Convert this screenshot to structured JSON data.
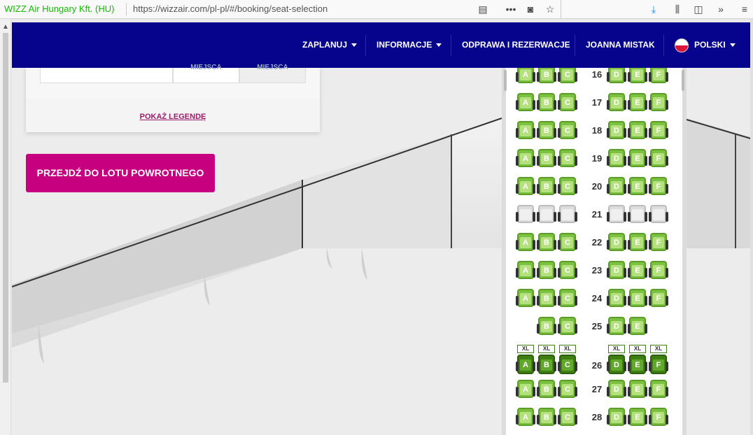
{
  "browser": {
    "identity": "WIZZ Air Hungary Kft. (HU)",
    "url": "https://wizzair.com/pl-pl/#/booking/seat-selection",
    "icons": [
      "reader-icon",
      "more-icon",
      "pocket-icon",
      "star-icon",
      "download-icon",
      "library-icon",
      "sidebar-icon",
      "overflow-icon",
      "menu-icon"
    ]
  },
  "nav": {
    "items": [
      {
        "label": "ZAPLANUJ",
        "dropdown": true
      },
      {
        "label": "INFORMACJE",
        "dropdown": true
      },
      {
        "label": "ODPRAWA I REZERWACJE",
        "dropdown": false
      },
      {
        "label": "JOANNA MISTAK",
        "dropdown": false
      },
      {
        "label": "POLSKI",
        "dropdown": true
      }
    ],
    "bg_color": "#06038d"
  },
  "panel": {
    "col1": "MIEJSCA",
    "col2": "MIEJSCA",
    "legend_link": "POKAŻ LEGENDĘ"
  },
  "cta": {
    "label": "PRZEJDŹ DO LOTU POWROTNEGO",
    "color": "#c6007e"
  },
  "seatmap": {
    "xl_label": "XL",
    "rows": [
      {
        "num": "16",
        "type": "normal",
        "left": [
          "A",
          "B",
          "C"
        ],
        "right": [
          "D",
          "E",
          "F"
        ]
      },
      {
        "num": "17",
        "type": "normal",
        "left": [
          "A",
          "B",
          "C"
        ],
        "right": [
          "D",
          "E",
          "F"
        ]
      },
      {
        "num": "18",
        "type": "normal",
        "left": [
          "A",
          "B",
          "C"
        ],
        "right": [
          "D",
          "E",
          "F"
        ]
      },
      {
        "num": "19",
        "type": "normal",
        "left": [
          "A",
          "B",
          "C"
        ],
        "right": [
          "D",
          "E",
          "F"
        ]
      },
      {
        "num": "20",
        "type": "normal",
        "left": [
          "A",
          "B",
          "C"
        ],
        "right": [
          "D",
          "E",
          "F"
        ]
      },
      {
        "num": "21",
        "type": "unavailable",
        "left": [
          "",
          "",
          ""
        ],
        "right": [
          "",
          "",
          ""
        ]
      },
      {
        "num": "22",
        "type": "normal",
        "left": [
          "A",
          "B",
          "C"
        ],
        "right": [
          "D",
          "E",
          "F"
        ]
      },
      {
        "num": "23",
        "type": "normal",
        "left": [
          "A",
          "B",
          "C"
        ],
        "right": [
          "D",
          "E",
          "F"
        ]
      },
      {
        "num": "24",
        "type": "normal",
        "left": [
          "A",
          "B",
          "C"
        ],
        "right": [
          "D",
          "E",
          "F"
        ]
      },
      {
        "num": "25",
        "type": "normal",
        "left": [
          null,
          "B",
          "C"
        ],
        "right": [
          "D",
          "E",
          null
        ]
      },
      {
        "num": "26",
        "type": "xl",
        "left": [
          "A",
          "B",
          "C"
        ],
        "right": [
          "D",
          "E",
          "F"
        ]
      },
      {
        "num": "27",
        "type": "normal",
        "left": [
          "A",
          "B",
          "C"
        ],
        "right": [
          "D",
          "E",
          "F"
        ]
      },
      {
        "num": "28",
        "type": "normal",
        "left": [
          "A",
          "B",
          "C"
        ],
        "right": [
          "D",
          "E",
          "F"
        ]
      }
    ],
    "colors": {
      "available": "#7dc142",
      "xl": "#3f7f12",
      "unavailable": "#dcdcdc"
    }
  }
}
